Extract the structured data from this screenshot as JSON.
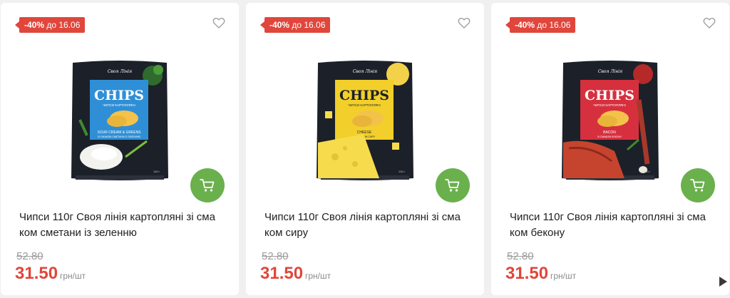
{
  "colors": {
    "sale_red": "#e0463b",
    "cart_green": "#6ab04c",
    "bag_dark": "#1c2029"
  },
  "products": [
    {
      "discount": "-40%",
      "promo_until": "до 16.06",
      "title_line1": "Чипси 110г Своя лінія картопляні зі сма",
      "title_line2": "ком сметани із зеленню",
      "old_price": "52.80",
      "price": "31.50",
      "unit": "грн/шт",
      "pack_brand": "Своя Лінія",
      "pack_name": "CHIPS",
      "pack_subtitle": "ЧИПСИ КАРТОПЛЯНІ",
      "pack_flavor": "SOUR CREAM & GREENS",
      "pack_flavor_ua": "ЗІ СМАКОМ СМЕТАНИ ІЗ ЗЕЛЕННЮ",
      "pack_weight": "110 г",
      "pack_color": "#2f8fd6"
    },
    {
      "discount": "-40%",
      "promo_until": "до 16.06",
      "title_line1": "Чипси 110г Своя лінія картопляні зі сма",
      "title_line2": "ком сиру",
      "old_price": "52.80",
      "price": "31.50",
      "unit": "грн/шт",
      "pack_brand": "Своя Лінія",
      "pack_name": "CHIPS",
      "pack_subtitle": "ЧИПСИ КАРТОПЛЯНІ",
      "pack_flavor": "CHEESE",
      "pack_flavor_ua": "ЗІ СМАКОМ СИРУ",
      "pack_weight": "110 г",
      "pack_color": "#f2cf2a"
    },
    {
      "discount": "-40%",
      "promo_until": "до 16.06",
      "title_line1": "Чипси 110г Своя лінія картопляні зі сма",
      "title_line2": "ком бекону",
      "old_price": "52.80",
      "price": "31.50",
      "unit": "грн/шт",
      "pack_brand": "Своя Лінія",
      "pack_name": "CHIPS",
      "pack_subtitle": "ЧИПСИ КАРТОПЛЯНІ",
      "pack_flavor": "BACON",
      "pack_flavor_ua": "ЗІ СМАКОМ БЕКОНУ",
      "pack_weight": "110 г",
      "pack_color": "#d6303e"
    }
  ],
  "icons": {
    "favorite": "heart-icon",
    "cart": "cart-icon",
    "next": "arrow-right-icon"
  }
}
